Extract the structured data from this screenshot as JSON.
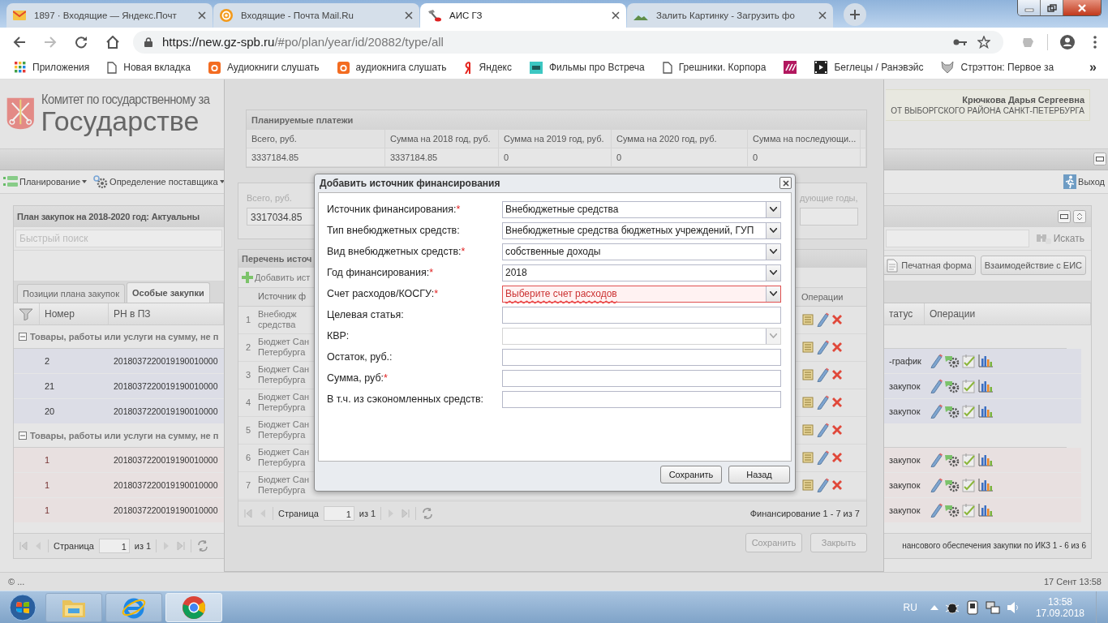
{
  "browser": {
    "tabs": [
      {
        "title": "1897 · Входящие — Яндекс.Почт",
        "selected": false,
        "kind": "mail"
      },
      {
        "title": "Входящие - Почта Mail.Ru",
        "selected": false,
        "kind": "at"
      },
      {
        "title": "АИС ГЗ",
        "selected": true,
        "kind": "tools"
      },
      {
        "title": "Залить Картинку - Загрузить фо",
        "selected": false,
        "kind": "image"
      }
    ],
    "url_host": "https://new.gz-spb.ru",
    "url_path": "/#po/plan/year/id/20882/type/all",
    "bookmarks": [
      {
        "label": "Приложения",
        "kind": "apps"
      },
      {
        "label": "Новая вкладка",
        "kind": "page"
      },
      {
        "label": "Аудиокниги слушать",
        "kind": "orange"
      },
      {
        "label": "аудиокнига слушать",
        "kind": "orange"
      },
      {
        "label": "Яндекс",
        "kind": "red"
      },
      {
        "label": "Фильмы про Встреча",
        "kind": "teal"
      },
      {
        "label": "Грешники. Корпора",
        "kind": "page"
      },
      {
        "kind": "magenta"
      },
      {
        "label": "Беглецы / Ранэвэйс",
        "kind": "film"
      },
      {
        "label": "Стрэттон: Первое за",
        "kind": "fox"
      }
    ],
    "more": "»"
  },
  "header": {
    "org_line": "Комитет по государственному за",
    "title": "Государстве",
    "user_name": "Крючкова Дарья Сергеевна",
    "user_org": "ОТ ВЫБОРГСКОГО РАЙОНА САНКТ-ПЕТЕРБУРГА"
  },
  "menu": [
    {
      "label": "Планирование",
      "kind": "list"
    },
    {
      "label": "Определение поставщика",
      "kind": "gear"
    }
  ],
  "logout": "Выход",
  "plan_panel": {
    "title": "План закупок на 2018-2020 год: Актуальны",
    "search_placeholder": "Быстрый поиск",
    "search_button": "Искать",
    "buttons": [
      "Печатная форма",
      "Взаимодействие с ЕИС"
    ],
    "tabs": [
      {
        "label": "Позиции плана закупок",
        "selected": false
      },
      {
        "label": "Особые закупки",
        "selected": true
      }
    ],
    "columns": [
      "Номер",
      "РН в ПЗ",
      "татус",
      "Операции"
    ],
    "groups": [
      {
        "title": "Товары, работы или услуги на сумму, не п",
        "color": "#dcdde6",
        "rows": [
          {
            "number": "2",
            "rn": "2018037220019190010000",
            "status": "-график"
          },
          {
            "number": "21",
            "rn": "2018037220019190010000",
            "status": "закупок"
          },
          {
            "number": "20",
            "rn": "2018037220019190010000",
            "status": "закупок"
          }
        ]
      },
      {
        "title": "Товары, работы или услуги на сумму, не п",
        "color": "#e8e0e0",
        "rows": [
          {
            "number": "1",
            "rn": "2018037220019190010000",
            "status": "закупок"
          },
          {
            "number": "1",
            "rn": "2018037220019190010000",
            "status": "закупок"
          },
          {
            "number": "1",
            "rn": "2018037220019190010000",
            "status": "закупок"
          }
        ]
      }
    ],
    "pager": {
      "page_label": "Страница",
      "page": "1",
      "of": "из 1",
      "summary": "нансового обеспечения закупки по ИКЗ 1 - 6 из 6"
    }
  },
  "funding_dialog": {
    "payments": {
      "title": "Планируемые платежи",
      "columns": [
        "Всего, руб.",
        "Сумма на 2018 год, руб.",
        "Сумма на 2019 год, руб.",
        "Сумма на 2020 год, руб.",
        "Сумма на последующи..."
      ],
      "row": [
        "3337184.85",
        "3337184.85",
        "0",
        "0",
        "0"
      ]
    },
    "totals": {
      "label": "Всего, руб.",
      "value": "3317034.85",
      "right_label": "дующие годы,"
    },
    "sources": {
      "title": "Перечень источ",
      "add": "Добавить ист",
      "columns": [
        "Источник ф",
        "Операции"
      ],
      "rows": [
        {
          "n": "1",
          "line1": "Внебюдж",
          "line2": "средства"
        },
        {
          "n": "2",
          "line1": "Бюджет Сан",
          "line2": "Петербурга"
        },
        {
          "n": "3",
          "line1": "Бюджет Сан",
          "line2": "Петербурга"
        },
        {
          "n": "4",
          "line1": "Бюджет Сан",
          "line2": "Петербурга"
        },
        {
          "n": "5",
          "line1": "Бюджет Сан",
          "line2": "Петербурга"
        },
        {
          "n": "6",
          "line1": "Бюджет Сан",
          "line2": "Петербурга"
        },
        {
          "n": "7",
          "line1": "Бюджет Сан",
          "line2": "Петербурга"
        }
      ]
    },
    "pager": {
      "page_label": "Страница",
      "page": "1",
      "of": "из 1",
      "summary": "Финансирование 1 - 7 из 7"
    },
    "buttons": [
      "Сохранить",
      "Закрыть"
    ]
  },
  "modal": {
    "title": "Добавить источник финансирования",
    "required_mark": "*",
    "fields": [
      {
        "label": "Источник финансирования:",
        "required": true,
        "kind": "combo",
        "value": "Внебюджетные средства"
      },
      {
        "label": "Тип внебюджетных средств:",
        "required": false,
        "kind": "combo",
        "value": "Внебюджетные средства бюджетных учреждений, ГУП"
      },
      {
        "label": "Вид внебюджетных средств:",
        "required": true,
        "kind": "combo",
        "value": "собственные доходы"
      },
      {
        "label": "Год финансирования:",
        "required": true,
        "kind": "combo",
        "value": "2018"
      },
      {
        "label": "Счет расходов/КОСГУ:",
        "required": true,
        "kind": "combo",
        "placeholder": "Выберите счет расходов",
        "invalid": true
      },
      {
        "label": "Целевая статья:",
        "required": false,
        "kind": "text"
      },
      {
        "label": "КВР:",
        "required": false,
        "kind": "combo",
        "disabled": true
      },
      {
        "label": "Остаток, руб.:",
        "required": false,
        "kind": "text"
      },
      {
        "label": "Сумма, руб:",
        "required": true,
        "kind": "text"
      },
      {
        "label": "В т.ч. из сэкономленных средств:",
        "required": false,
        "kind": "text"
      }
    ],
    "buttons": [
      "Сохранить",
      "Назад"
    ]
  },
  "status_bar": {
    "left": "© ...",
    "right": "17 Сент 13:58"
  },
  "taskbar": {
    "apps": [
      {
        "kind": "explorer",
        "selected": false
      },
      {
        "kind": "ie",
        "selected": false
      },
      {
        "kind": "chrome",
        "selected": true
      }
    ],
    "lang": "RU",
    "time": "13:58",
    "date": "17.09.2018"
  }
}
